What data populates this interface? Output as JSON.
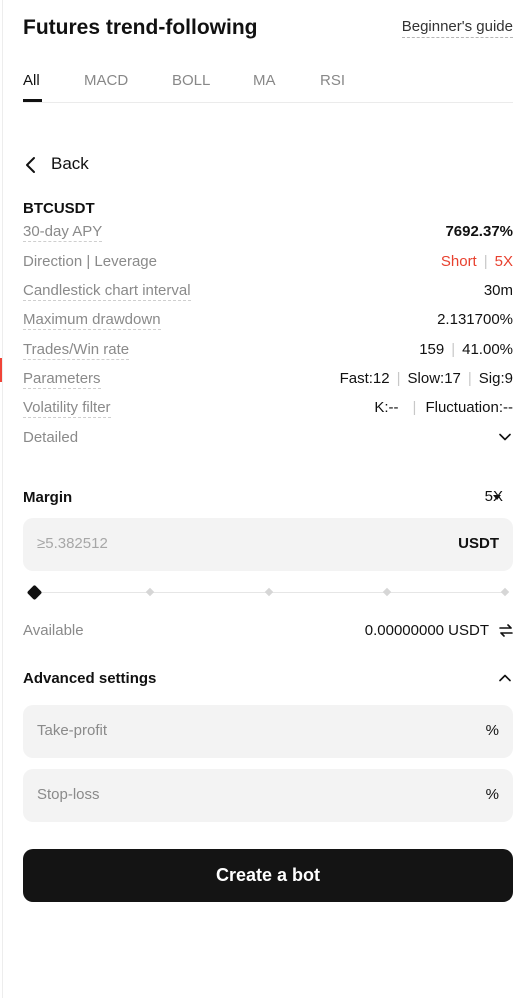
{
  "header": {
    "title": "Futures trend-following",
    "guide_link": "Beginner's guide"
  },
  "tabs": [
    {
      "label": "All",
      "active": true
    },
    {
      "label": "MACD",
      "active": false
    },
    {
      "label": "BOLL",
      "active": false
    },
    {
      "label": "MA",
      "active": false
    },
    {
      "label": "RSI",
      "active": false
    }
  ],
  "back": {
    "label": "Back"
  },
  "strategy": {
    "symbol": "BTCUSDT",
    "apy": {
      "label": "30-day APY",
      "value": "7692.37%"
    },
    "direction": {
      "label": "Direction | Leverage",
      "side": "Short",
      "leverage": "5X"
    },
    "interval": {
      "label": "Candlestick chart interval",
      "value": "30m"
    },
    "drawdown": {
      "label": "Maximum drawdown",
      "value": "2.131700%"
    },
    "trades": {
      "label": "Trades/Win rate",
      "count": "159",
      "win_rate": "41.00%"
    },
    "parameters": {
      "label": "Parameters",
      "fast": "Fast:12",
      "slow": "Slow:17",
      "sig": "Sig:9"
    },
    "volatility": {
      "label": "Volatility filter",
      "k": "K:--",
      "fluctuation": "Fluctuation:--"
    },
    "detailed": {
      "label": "Detailed"
    }
  },
  "margin": {
    "label": "Margin",
    "leverage": "5X",
    "placeholder": "≥5.382512",
    "unit": "USDT",
    "slider_value": 0
  },
  "available": {
    "label": "Available",
    "value": "0.00000000 USDT"
  },
  "advanced": {
    "label": "Advanced settings",
    "take_profit": {
      "placeholder": "Take-profit",
      "unit": "%"
    },
    "stop_loss": {
      "placeholder": "Stop-loss",
      "unit": "%"
    }
  },
  "cta": {
    "label": "Create a bot"
  },
  "colors": {
    "positive": "#1a9a56",
    "negative": "#e8412f",
    "primary": "#141414"
  }
}
